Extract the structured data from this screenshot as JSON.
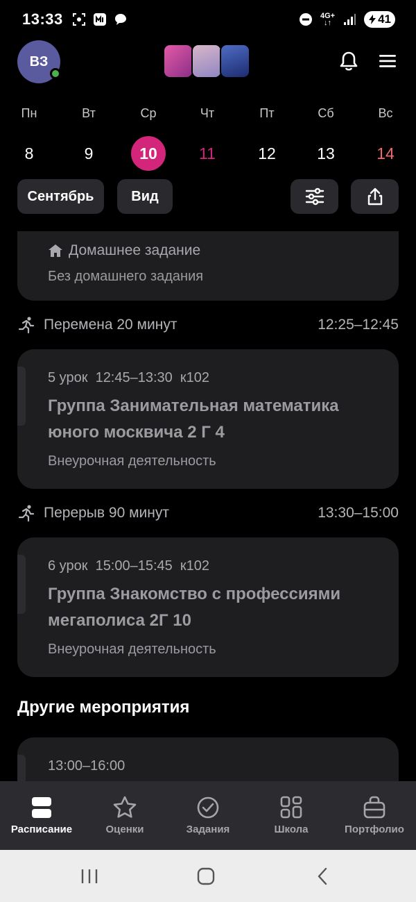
{
  "status_bar": {
    "time": "13:33",
    "network": "4G+",
    "battery": "41"
  },
  "header": {
    "avatar_initials": "ВЗ",
    "logo_colors": [
      "#c04e9a",
      "#b7a2c9",
      "#2b3f9a"
    ]
  },
  "week": {
    "days": [
      {
        "name": "Пн",
        "num": "8",
        "style": "normal"
      },
      {
        "name": "Вт",
        "num": "9",
        "style": "normal"
      },
      {
        "name": "Ср",
        "num": "10",
        "style": "selected"
      },
      {
        "name": "Чт",
        "num": "11",
        "style": "pink"
      },
      {
        "name": "Пт",
        "num": "12",
        "style": "normal"
      },
      {
        "name": "Сб",
        "num": "13",
        "style": "normal"
      },
      {
        "name": "Вс",
        "num": "14",
        "style": "red"
      }
    ]
  },
  "toolbar": {
    "month_label": "Сентябрь",
    "view_label": "Вид"
  },
  "schedule": {
    "homework_card": {
      "label": "Домашнее задание",
      "value": "Без домашнего задания"
    },
    "break1": {
      "label": "Перемена 20 минут",
      "time": "12:25–12:45"
    },
    "lesson5": {
      "meta": "5 урок  12:45–13:30  к102",
      "title": "Группа Занимательная математика юного москвича 2 Г 4",
      "type": "Внеурочная деятельность"
    },
    "break2": {
      "label": "Перерыв 90 минут",
      "time": "13:30–15:00"
    },
    "lesson6": {
      "meta": "6 урок  15:00–15:45  к102",
      "title": "Группа Знакомство с профессиями мегаполиса  2Г 10",
      "type": "Внеурочная деятельность"
    },
    "other_title": "Другие мероприятия",
    "event_time": "13:00–16:00"
  },
  "bottom_nav": {
    "items": [
      {
        "label": "Расписание",
        "icon": "schedule-icon",
        "active": true
      },
      {
        "label": "Оценки",
        "icon": "star-icon",
        "active": false
      },
      {
        "label": "Задания",
        "icon": "check-circle-icon",
        "active": false
      },
      {
        "label": "Школа",
        "icon": "grid-icon",
        "active": false
      },
      {
        "label": "Портфолио",
        "icon": "briefcase-icon",
        "active": false
      }
    ]
  },
  "colors": {
    "accent": "#d3257a",
    "background": "#000000",
    "card": "#1e1e21"
  }
}
